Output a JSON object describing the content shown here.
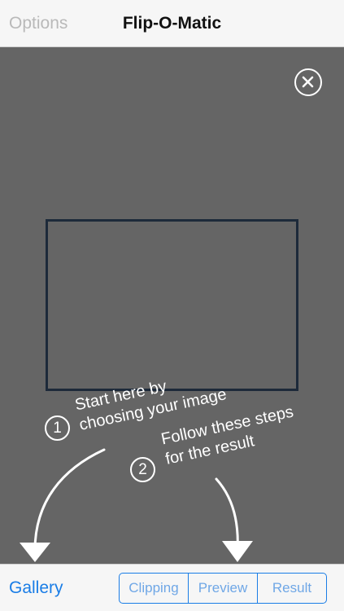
{
  "navbar": {
    "left_label": "Options",
    "title": "Flip-O-Matic"
  },
  "stage": {
    "close_icon": "close-icon"
  },
  "instructions": {
    "step1_number": "1",
    "step1_line1": "Start here by",
    "step1_line2": "choosing your image",
    "step2_number": "2",
    "step2_line1": "Follow these steps",
    "step2_line2": "for the result"
  },
  "toolbar": {
    "gallery_label": "Gallery",
    "segments": [
      "Clipping",
      "Preview",
      "Result"
    ]
  },
  "colors": {
    "accent": "#1a7de6",
    "stage_bg": "#656565",
    "frame_border": "#1d2a3a"
  }
}
